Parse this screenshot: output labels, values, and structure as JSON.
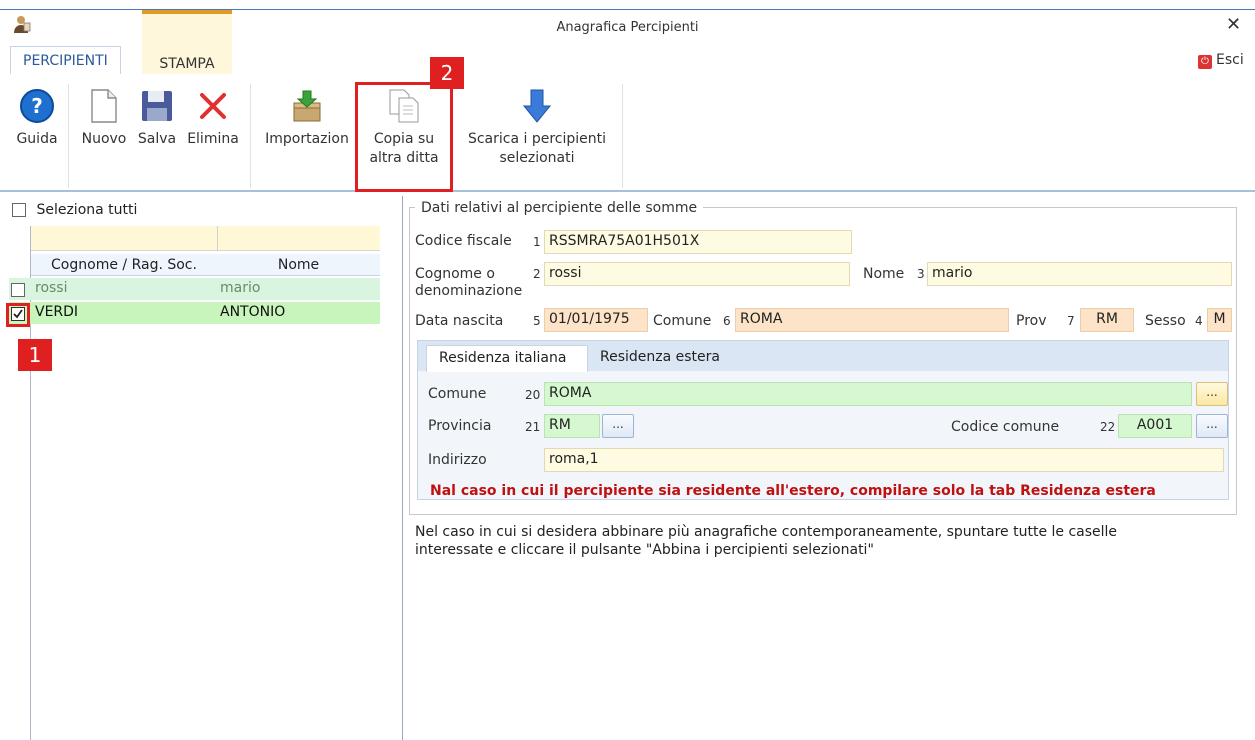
{
  "window": {
    "title": "Anagrafica Percipienti",
    "close": "✕",
    "esci": "Esci"
  },
  "ribbon_tabs": [
    {
      "label": "PERCIPIENTI"
    },
    {
      "label": "STAMPA"
    }
  ],
  "ribbon": {
    "guida": "Guida",
    "nuovo": "Nuovo",
    "salva": "Salva",
    "elimina": "Elimina",
    "importazione": "Importazion",
    "copia_line1": "Copia su",
    "copia_line2": "altra ditta",
    "scarica_line1": "Scarica i percipienti",
    "scarica_line2": "selezionati"
  },
  "badges": {
    "one": "1",
    "two": "2"
  },
  "list": {
    "select_all": "Seleziona tutti",
    "columns": [
      "Cognome / Rag. Soc.",
      "Nome"
    ],
    "rows": [
      {
        "cognome": "rossi",
        "nome": "mario",
        "checked": false
      },
      {
        "cognome": "VERDI",
        "nome": "ANTONIO",
        "checked": true
      }
    ]
  },
  "form": {
    "section_title": "Dati relativi al percipiente delle somme",
    "codice_fiscale": {
      "label": "Codice fiscale",
      "num": "1",
      "value": "RSSMRA75A01H501X"
    },
    "cognome": {
      "label1": "Cognome o",
      "label2": "denominazione",
      "num": "2",
      "value": "rossi"
    },
    "nome": {
      "label": "Nome",
      "num": "3",
      "value": "mario"
    },
    "data_nascita": {
      "label": "Data nascita",
      "num": "5",
      "value": "01/01/1975"
    },
    "comune_nascita": {
      "label": "Comune",
      "num": "6",
      "value": "ROMA"
    },
    "prov": {
      "label": "Prov",
      "num": "7",
      "value": "RM"
    },
    "sesso": {
      "label": "Sesso",
      "num": "4",
      "value": "M"
    },
    "residenza_tabs": [
      "Residenza italiana",
      "Residenza estera"
    ],
    "res_comune": {
      "label": "Comune",
      "num": "20",
      "value": "ROMA"
    },
    "res_provincia": {
      "label": "Provincia",
      "num": "21",
      "value": "RM"
    },
    "codice_comune": {
      "label": "Codice comune",
      "num": "22",
      "value": "A001"
    },
    "indirizzo": {
      "label": "Indirizzo",
      "value": "roma,1"
    },
    "dots": "...",
    "warning": "Nal caso in cui il percipiente sia residente all'estero, compilare solo la tab Residenza estera",
    "info_line1": "Nel caso in cui si desidera abbinare più anagrafiche contemporaneamente, spuntare tutte le caselle",
    "info_line2": "interessate e cliccare il pulsante \"Abbina i percipienti selezionati\""
  },
  "colors": {
    "accent": "#2c5a9a",
    "highlight_red": "#e02020",
    "row_green": "#d6f8d0",
    "field_yellow": "#fffbe2",
    "field_orange": "#fde3c8"
  }
}
